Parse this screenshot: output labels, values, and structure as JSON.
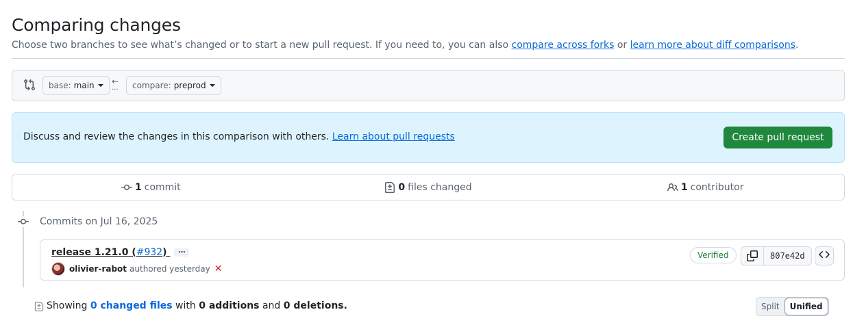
{
  "header": {
    "title": "Comparing changes",
    "subtitle_prefix": "Choose two branches to see what’s changed or to start a new pull request. If you need to, you can also ",
    "link_forks": "compare across forks",
    "subtitle_or": " or ",
    "link_diff": "learn more about diff comparisons",
    "subtitle_end": "."
  },
  "range": {
    "base_prefix": "base:",
    "base_branch": "main",
    "compare_prefix": "compare:",
    "compare_branch": "preprod",
    "arrow": "←",
    "dots": "..."
  },
  "flash": {
    "message": "Discuss and review the changes in this comparison with others. ",
    "link": "Learn about pull requests",
    "button": "Create pull request"
  },
  "summary": {
    "commits_count": "1",
    "commits_label": "commit",
    "files_count": "0",
    "files_label": "files changed",
    "contributors_count": "1",
    "contributors_label": "contributor"
  },
  "timeline": {
    "heading": "Commits on Jul 16, 2025"
  },
  "commit": {
    "title_text": "release 1.21.0 (",
    "pr_ref": "#932",
    "title_close": ")",
    "ellipsis": "…",
    "author": "olivier-rabot",
    "meta": "authored yesterday",
    "status_mark": "✕",
    "verified": "Verified",
    "sha": "807e42d"
  },
  "diffbar": {
    "showing": "Showing ",
    "changed_files": "0 changed files",
    "with": " with ",
    "additions": "0 additions",
    "and": " and ",
    "deletions": "0 deletions.",
    "split": "Split",
    "unified": "Unified"
  },
  "colors": {
    "primary_button": "#1f883d",
    "link": "#0969da",
    "flash_bg": "#ddf4ff",
    "verified": "#1a7f37",
    "error": "#cf222e"
  }
}
